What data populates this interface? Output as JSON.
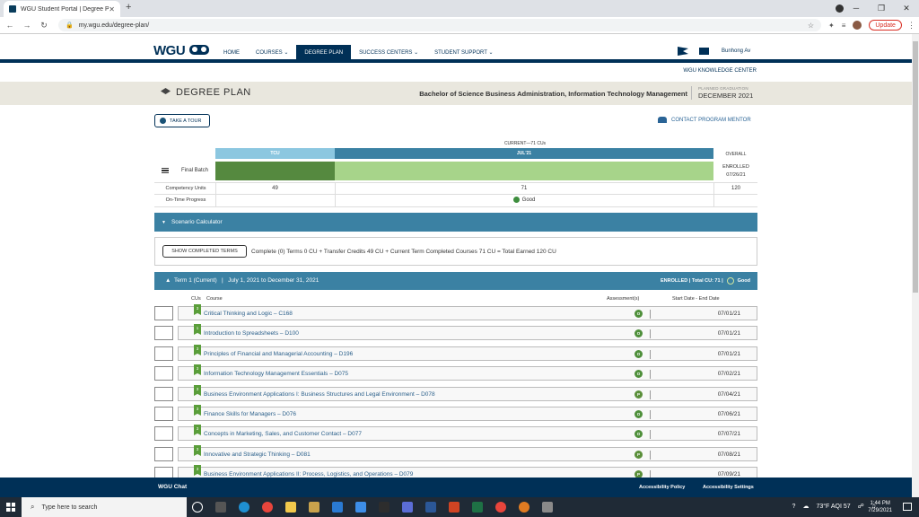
{
  "browser": {
    "tab_title": "WGU Student Portal | Degree Pl...",
    "url": "my.wgu.edu/degree-plan/",
    "update_label": "Update"
  },
  "header": {
    "logo": "WGU",
    "nav": [
      "HOME",
      "COURSES ⌄",
      "DEGREE PLAN",
      "SUCCESS CENTERS ⌄",
      "STUDENT SUPPORT ⌄"
    ],
    "user_name": "Bunhong Av",
    "knowledge_center": "WGU KNOWLEDGE CENTER"
  },
  "title_bar": {
    "title": "DEGREE PLAN",
    "program": "Bachelor of Science Business Administration, Information Technology Management",
    "grad_label": "PLANNED GRADUATION",
    "grad_value": "DECEMBER 2021"
  },
  "actions": {
    "tour": "TAKE A TOUR",
    "mentor": "CONTACT PROGRAM MENTOR"
  },
  "progress": {
    "current_label": "CURRENT—71 CUs",
    "col_cu": "TCU",
    "col_term": "JUL'21",
    "col_overall": "OVERALL",
    "batch_label": "Final Batch",
    "enrolled_line1": "ENROLLED",
    "enrolled_line2": "07/26/21",
    "cu_label": "Competency Units",
    "cu_transfer": "49",
    "cu_term": "71",
    "cu_total": "120",
    "ontime_label": "On-Time Progress",
    "ontime_value": "Good"
  },
  "scenario": {
    "title": "Scenario Calculator",
    "button": "SHOW COMPLETED TERMS",
    "summary": "Complete (0) Terms 0 CU + Transfer Credits 49 CU + Current Term Completed Courses 71 CU = Total Earned 120 CU"
  },
  "term": {
    "title": "Term 1 (Current)",
    "range": "July 1, 2021 to December 31, 2021",
    "status": "ENROLLED",
    "total": "Total CU: 71",
    "rating": "Good",
    "col_cus": "CUs",
    "col_course": "Course",
    "col_assess": "Assessment(s)",
    "col_dates": "Start Date - End Date"
  },
  "courses": [
    {
      "cu": "3",
      "name": "Critical Thinking and Logic – C168",
      "assess": "O",
      "date": "07/01/21"
    },
    {
      "cu": "1",
      "name": "Introduction to Spreadsheets – D100",
      "assess": "O",
      "date": "07/01/21"
    },
    {
      "cu": "3",
      "name": "Principles of Financial and Managerial Accounting – D196",
      "assess": "O",
      "date": "07/01/21"
    },
    {
      "cu": "3",
      "name": "Information Technology Management Essentials – D075",
      "assess": "O",
      "date": "07/02/21"
    },
    {
      "cu": "3",
      "name": "Business Environment Applications I: Business Structures and Legal Environment – D078",
      "assess": "P",
      "date": "07/04/21"
    },
    {
      "cu": "3",
      "name": "Finance Skills for Managers – D076",
      "assess": "O",
      "date": "07/06/21"
    },
    {
      "cu": "3",
      "name": "Concepts in Marketing, Sales, and Customer Contact – D077",
      "assess": "O",
      "date": "07/07/21"
    },
    {
      "cu": "3",
      "name": "Innovative and Strategic Thinking – D081",
      "assess": "P",
      "date": "07/08/21"
    },
    {
      "cu": "3",
      "name": "Business Environment Applications II: Process, Logistics, and Operations – D079",
      "assess": "P",
      "date": "07/09/21"
    }
  ],
  "footer": {
    "chat": "WGU Chat",
    "acc_policy": "Accessibility Policy",
    "acc_settings": "Accessibility Settings"
  },
  "taskbar": {
    "search": "Type here to search",
    "weather": "73°F  AQI 57",
    "time": "1:44 PM",
    "date": "7/29/2021"
  },
  "colors": {
    "navy": "#003057",
    "teal": "#3b81a3",
    "green_dark": "#55893f",
    "green_light": "#a7d48a"
  }
}
